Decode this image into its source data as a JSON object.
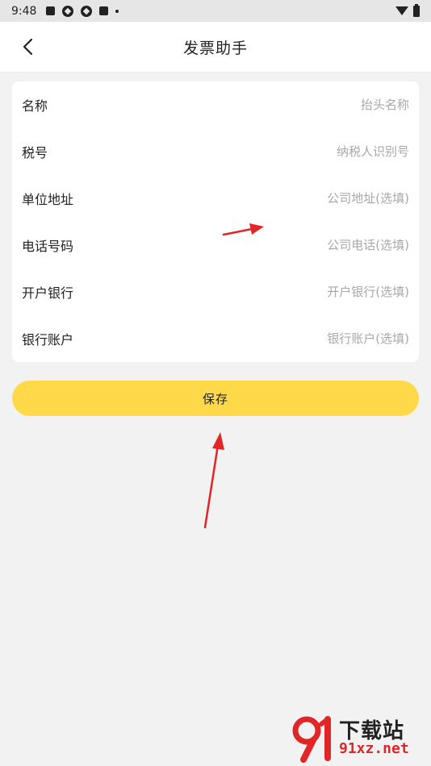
{
  "status_bar": {
    "time": "9:48"
  },
  "header": {
    "title": "发票助手",
    "back_icon": "chevron-left-icon"
  },
  "form": {
    "fields": [
      {
        "label": "名称",
        "placeholder": "抬头名称"
      },
      {
        "label": "税号",
        "placeholder": "纳税人识别号"
      },
      {
        "label": "单位地址",
        "placeholder": "公司地址(选填)"
      },
      {
        "label": "电话号码",
        "placeholder": "公司电话(选填)"
      },
      {
        "label": "开户银行",
        "placeholder": "开户银行(选填)"
      },
      {
        "label": "银行账户",
        "placeholder": "银行账户(选填)"
      }
    ]
  },
  "save_button": {
    "label": "保存"
  },
  "watermark": {
    "title": "下载站",
    "url": "91xz.net"
  },
  "colors": {
    "accent": "#ffd94a",
    "annotation": "#e02626",
    "background": "#f2f2f2"
  }
}
